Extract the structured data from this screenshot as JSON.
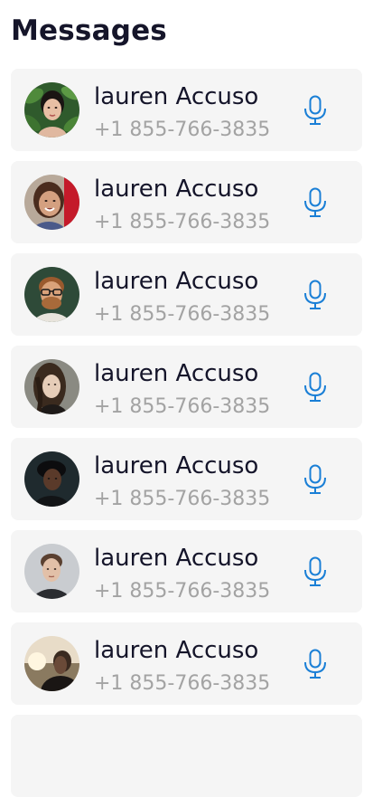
{
  "header": {
    "title": "Messages"
  },
  "contacts": [
    {
      "name": "lauren Accuso",
      "phone": "+1 855-766-3835",
      "avatar": "avatar-woman-plants",
      "action_icon": "mic-icon"
    },
    {
      "name": "lauren Accuso",
      "phone": "+1 855-766-3835",
      "avatar": "avatar-woman-smiling",
      "action_icon": "mic-icon"
    },
    {
      "name": "lauren Accuso",
      "phone": "+1 855-766-3835",
      "avatar": "avatar-man-glasses",
      "action_icon": "mic-icon"
    },
    {
      "name": "lauren Accuso",
      "phone": "+1 855-766-3835",
      "avatar": "avatar-long-hair",
      "action_icon": "mic-icon"
    },
    {
      "name": "lauren Accuso",
      "phone": "+1 855-766-3835",
      "avatar": "avatar-dark-hat",
      "action_icon": "mic-icon"
    },
    {
      "name": "lauren Accuso",
      "phone": "+1 855-766-3835",
      "avatar": "avatar-young-man",
      "action_icon": "mic-icon"
    },
    {
      "name": "lauren Accuso",
      "phone": "+1 855-766-3835",
      "avatar": "avatar-sunset-profile",
      "action_icon": "mic-icon"
    }
  ],
  "colors": {
    "title": "#15152a",
    "name": "#15152a",
    "phone": "#a3a3a3",
    "card_bg": "#f5f5f5",
    "accent": "#1a7fd6"
  }
}
